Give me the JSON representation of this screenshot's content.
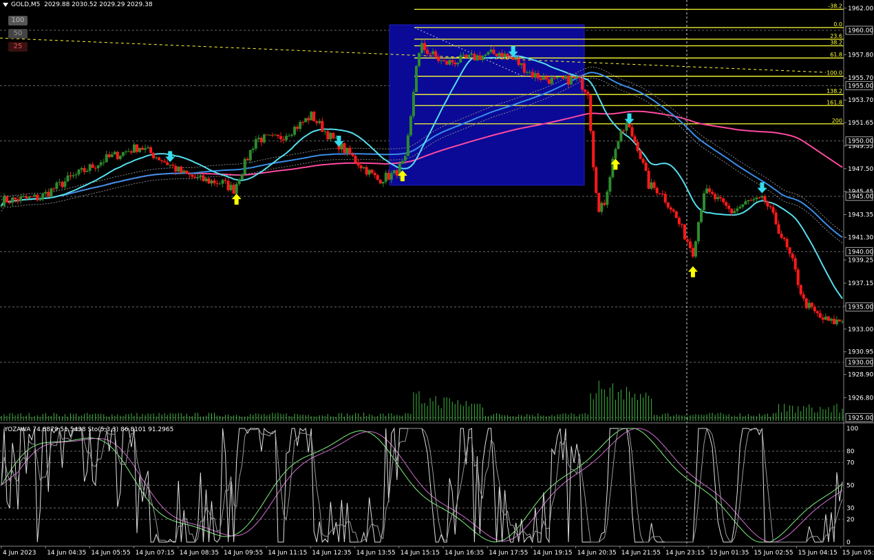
{
  "header": {
    "symbol": "GOLD,M5",
    "ohlc": "2029.88 2030.52 2029.29 2029.38"
  },
  "timeframe_buttons": [
    "100",
    "50",
    "25"
  ],
  "indicator_header": "YOZAWA 74.8879 51.5438  Sto(5,3,3) 86.8101 91.2965",
  "colors": {
    "background": "#000000",
    "bull": "#2e8b2e",
    "bear": "#ff1a1a",
    "ma_fast": "#55e0f0",
    "ma_mid": "#3a8fe8",
    "ma_slow": "#ff4aa0",
    "fib": "#ffff33",
    "zone": "#0a0a96",
    "arrow_up": "#ffff00",
    "arrow_down": "#33ddee",
    "grid": "#6a6a6a",
    "volume": "#3fb83f"
  },
  "chart_data": [
    {
      "type": "candlestick",
      "title": "",
      "x_tick_labels": [
        "4 Jun 2023",
        "14 Jun 04:35",
        "14 Jun 05:55",
        "14 Jun 07:15",
        "14 Jun 08:35",
        "14 Jun 09:55",
        "14 Jun 11:15",
        "14 Jun 12:35",
        "14 Jun 13:55",
        "14 Jun 15:15",
        "14 Jun 16:35",
        "14 Jun 17:55",
        "14 Jun 19:15",
        "14 Jun 20:35",
        "14 Jun 21:55",
        "14 Jun 23:15",
        "15 Jun 01:35",
        "15 Jun 02:55",
        "15 Jun 04:15",
        "15 Jun 05:35"
      ],
      "y_tick_labels": [
        "1962.00",
        "1957.80",
        "1955.70",
        "1953.70",
        "1951.65",
        "1949.55",
        "1947.50",
        "1945.45",
        "1943.35",
        "1941.30",
        "1939.25",
        "1937.15",
        "1935.10",
        "1933.00",
        "1930.95",
        "1928.90",
        "1926.80"
      ],
      "price_levels": [
        {
          "price": 1960.0,
          "label": "1960.00"
        },
        {
          "price": 1955.0,
          "label": "1955.00"
        },
        {
          "price": 1950.0,
          "label": "1950.00"
        },
        {
          "price": 1945.0,
          "label": "1945.00"
        },
        {
          "price": 1940.0,
          "label": "1940.00"
        },
        {
          "price": 1935.0,
          "label": "1935.00"
        },
        {
          "price": 1930.0,
          "label": "1930.00"
        },
        {
          "price": 1925.0,
          "label": "1925.00"
        }
      ],
      "fibonacci_levels": [
        {
          "label": "-38.2",
          "price": 1961.9
        },
        {
          "label": "0.0",
          "price": 1960.25
        },
        {
          "label": "23.6",
          "price": 1959.2
        },
        {
          "label": "38.2",
          "price": 1958.6
        },
        {
          "label": "61.8",
          "price": 1957.5
        },
        {
          "label": "100.0",
          "price": 1955.85
        },
        {
          "label": "138.2",
          "price": 1954.2
        },
        {
          "label": "161.8",
          "price": 1953.2
        },
        {
          "label": "200",
          "price": 1951.55
        }
      ],
      "ylim": [
        1925.0,
        1963.0
      ],
      "series": [
        {
          "name": "",
          "kind": "candles",
          "count": 241,
          "start_price": 1944.6,
          "end_price": 1933.8
        },
        {
          "name": "",
          "kind": "ma_fast"
        },
        {
          "name": "",
          "kind": "ma_mid"
        },
        {
          "name": "",
          "kind": "ma_slow"
        }
      ],
      "signals": {
        "up": [
          "14 Jun 09:55",
          "14 Jun 14:30",
          "14 Jun 21:15",
          "14 Jun 23:20"
        ],
        "down": [
          "14 Jun 08:15",
          "14 Jun 12:35",
          "14 Jun 18:00",
          "14 Jun 21:45",
          "15 Jun 03:00"
        ]
      }
    },
    {
      "type": "line",
      "title": "",
      "ylim": [
        0,
        100
      ],
      "y_tick_labels": [
        "100",
        "80",
        "70",
        "50",
        "30",
        "20",
        "0"
      ],
      "levels": [
        80,
        70,
        50,
        30,
        20
      ],
      "series": [
        {
          "name": "YOZAWA",
          "last_values": [
            74.8879,
            51.5438
          ]
        },
        {
          "name": "Sto(5,3,3)",
          "last_values": [
            86.8101,
            91.2965
          ]
        }
      ]
    }
  ]
}
